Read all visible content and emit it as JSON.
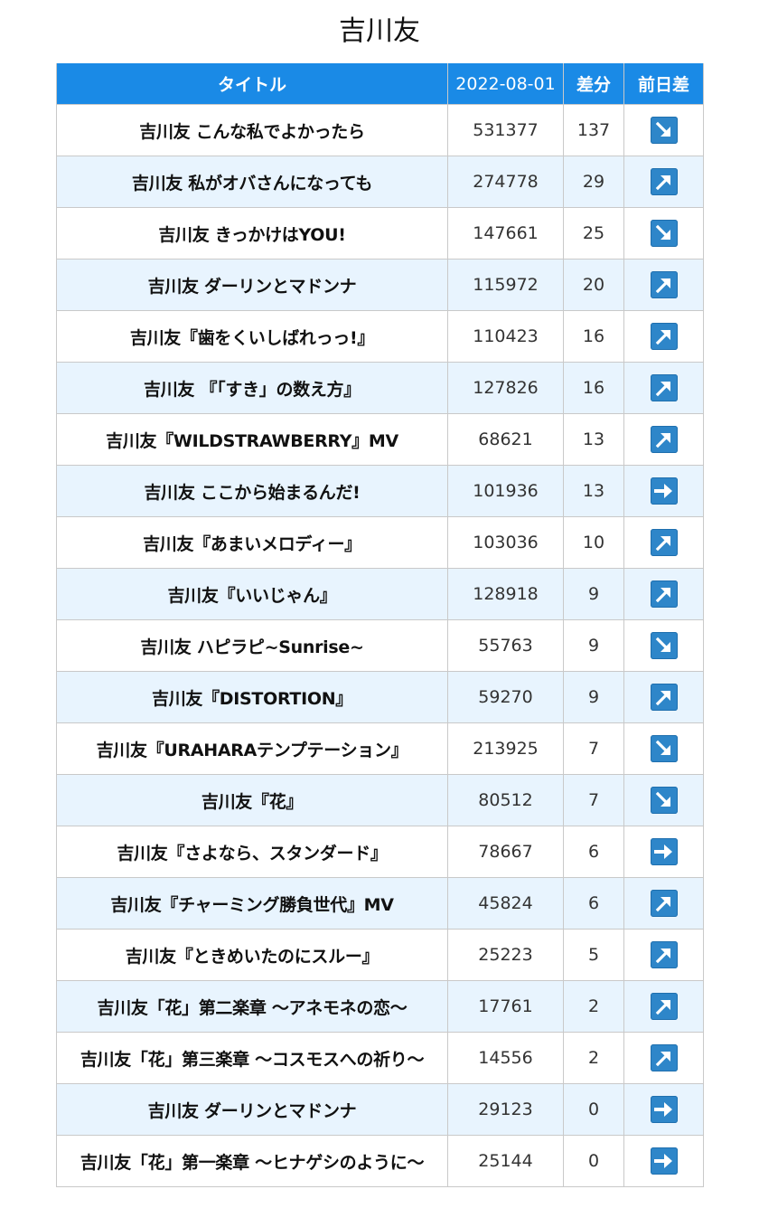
{
  "page": {
    "title": "吉川友"
  },
  "table": {
    "headers": {
      "title": "タイトル",
      "count": "2022-08-01",
      "diff": "差分",
      "trend": "前日差"
    },
    "trend_icon_color": "#2e86c9",
    "header_color": "#1a8ae6",
    "stripe_color": "#e8f4fe",
    "rows": [
      {
        "title": "吉川友 こんな私でよかったら",
        "count": "531377",
        "diff": "137",
        "trend": "down"
      },
      {
        "title": "吉川友 私がオバさんになっても",
        "count": "274778",
        "diff": "29",
        "trend": "up"
      },
      {
        "title": "吉川友 きっかけはYOU!",
        "count": "147661",
        "diff": "25",
        "trend": "down"
      },
      {
        "title": "吉川友 ダーリンとマドンナ",
        "count": "115972",
        "diff": "20",
        "trend": "up"
      },
      {
        "title": "吉川友『歯をくいしばれっっ!』",
        "count": "110423",
        "diff": "16",
        "trend": "up"
      },
      {
        "title": "吉川友 『「すき」の数え方』",
        "count": "127826",
        "diff": "16",
        "trend": "up"
      },
      {
        "title": "吉川友『WILDSTRAWBERRY』MV",
        "count": "68621",
        "diff": "13",
        "trend": "up"
      },
      {
        "title": "吉川友 ここから始まるんだ!",
        "count": "101936",
        "diff": "13",
        "trend": "flat"
      },
      {
        "title": "吉川友『あまいメロディー』",
        "count": "103036",
        "diff": "10",
        "trend": "up"
      },
      {
        "title": "吉川友『いいじゃん』",
        "count": "128918",
        "diff": "9",
        "trend": "up"
      },
      {
        "title": "吉川友 ハピラピ~Sunrise~",
        "count": "55763",
        "diff": "9",
        "trend": "down"
      },
      {
        "title": "吉川友『DISTORTION』",
        "count": "59270",
        "diff": "9",
        "trend": "up"
      },
      {
        "title": "吉川友『URAHARAテンプテーション』",
        "count": "213925",
        "diff": "7",
        "trend": "down"
      },
      {
        "title": "吉川友『花』",
        "count": "80512",
        "diff": "7",
        "trend": "down"
      },
      {
        "title": "吉川友『さよなら、スタンダード』",
        "count": "78667",
        "diff": "6",
        "trend": "flat"
      },
      {
        "title": "吉川友『チャーミング勝負世代』MV",
        "count": "45824",
        "diff": "6",
        "trend": "up"
      },
      {
        "title": "吉川友『ときめいたのにスルー』",
        "count": "25223",
        "diff": "5",
        "trend": "up"
      },
      {
        "title": "吉川友「花」第二楽章 〜アネモネの恋〜",
        "count": "17761",
        "diff": "2",
        "trend": "up"
      },
      {
        "title": "吉川友「花」第三楽章 〜コスモスへの祈り〜",
        "count": "14556",
        "diff": "2",
        "trend": "up"
      },
      {
        "title": "吉川友 ダーリンとマドンナ",
        "count": "29123",
        "diff": "0",
        "trend": "flat"
      },
      {
        "title": "吉川友「花」第一楽章 〜ヒナゲシのように〜",
        "count": "25144",
        "diff": "0",
        "trend": "flat"
      }
    ]
  }
}
